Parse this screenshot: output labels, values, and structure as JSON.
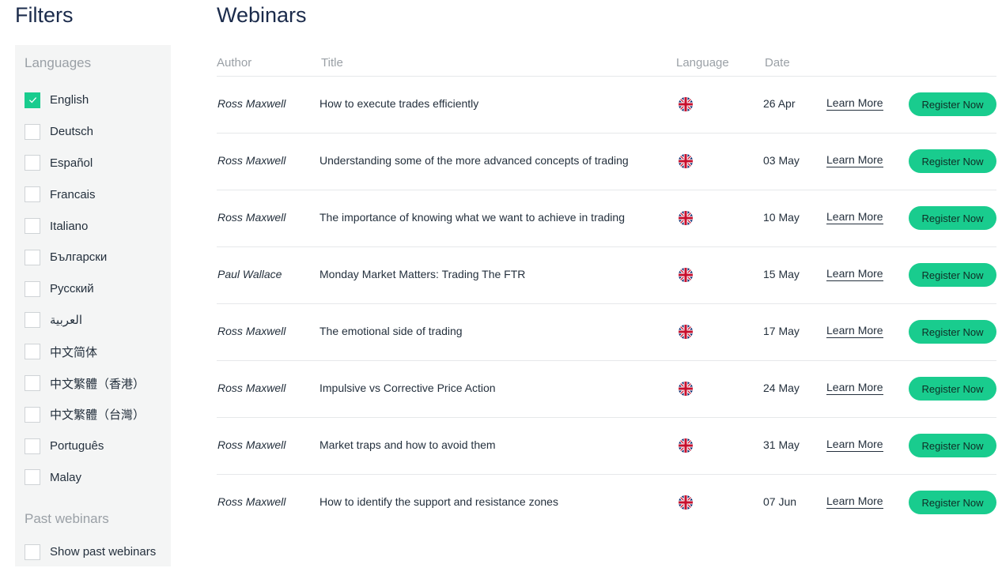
{
  "filters": {
    "title": "Filters",
    "languages_heading": "Languages",
    "languages": [
      {
        "label": "English",
        "checked": true
      },
      {
        "label": "Deutsch",
        "checked": false
      },
      {
        "label": "Español",
        "checked": false
      },
      {
        "label": "Francais",
        "checked": false
      },
      {
        "label": "Italiano",
        "checked": false
      },
      {
        "label": "Български",
        "checked": false
      },
      {
        "label": "Русский",
        "checked": false
      },
      {
        "label": "العربية",
        "checked": false
      },
      {
        "label": "中文简体",
        "checked": false
      },
      {
        "label": "中文繁體（香港）",
        "checked": false
      },
      {
        "label": "中文繁體（台灣）",
        "checked": false
      },
      {
        "label": "Português",
        "checked": false
      },
      {
        "label": "Malay",
        "checked": false
      }
    ],
    "past_heading": "Past webinars",
    "past_option": {
      "label": "Show past webinars",
      "checked": false
    }
  },
  "webinars": {
    "title": "Webinars",
    "columns": {
      "author": "Author",
      "title": "Title",
      "language": "Language",
      "date": "Date"
    },
    "learn_label": "Learn More",
    "register_label": "Register Now",
    "flag_icon": "uk-flag-icon",
    "rows": [
      {
        "author": "Ross Maxwell",
        "title": "How to execute trades efficiently",
        "date": "26 Apr"
      },
      {
        "author": "Ross Maxwell",
        "title": "Understanding some of the more advanced concepts of trading",
        "date": "03 May"
      },
      {
        "author": "Ross Maxwell",
        "title": "The importance of knowing what we want to achieve in trading",
        "date": "10 May"
      },
      {
        "author": "Paul Wallace",
        "title": "Monday Market Matters: Trading The FTR",
        "date": "15 May"
      },
      {
        "author": "Ross Maxwell",
        "title": "The emotional side of trading",
        "date": "17 May"
      },
      {
        "author": "Ross Maxwell",
        "title": "Impulsive vs Corrective Price Action",
        "date": "24 May"
      },
      {
        "author": "Ross Maxwell",
        "title": "Market traps and how to avoid them",
        "date": "31 May"
      },
      {
        "author": "Ross Maxwell",
        "title": "How to identify the support and resistance zones",
        "date": "07 Jun"
      }
    ]
  },
  "colors": {
    "accent": "#19cc8e",
    "heading": "#1b2b4b",
    "muted": "#9aa0a6",
    "sidebar_bg": "#f4f5f5"
  }
}
